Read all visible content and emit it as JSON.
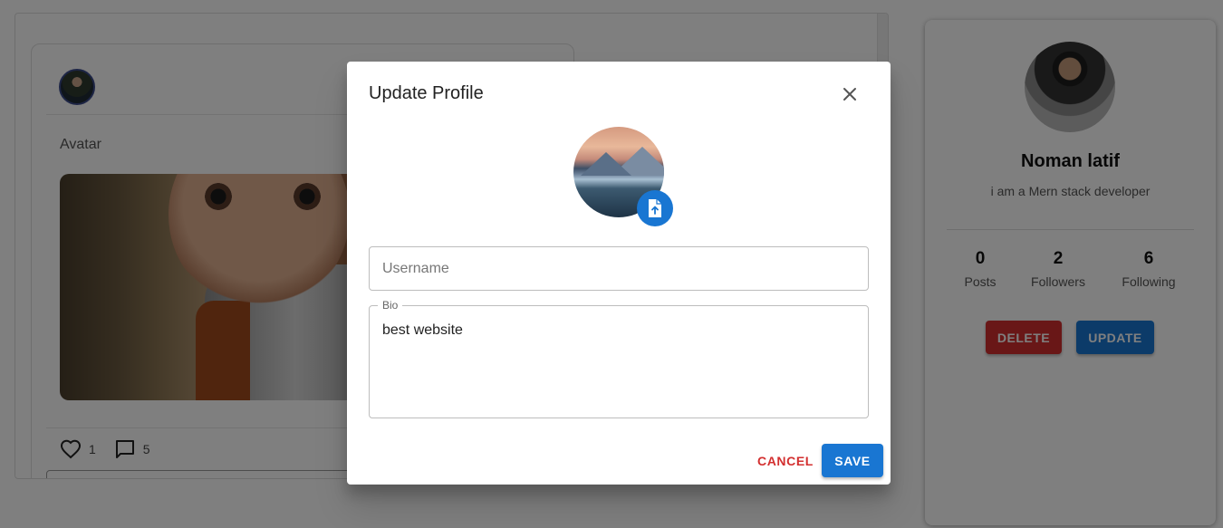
{
  "post": {
    "caption": "Avatar",
    "likes": "1",
    "comments": "5"
  },
  "profile": {
    "name": "Noman latif",
    "bio": "i am a Mern stack developer",
    "stats": [
      {
        "value": "0",
        "label": "Posts"
      },
      {
        "value": "2",
        "label": "Followers"
      },
      {
        "value": "6",
        "label": "Following"
      }
    ],
    "delete_label": "DELETE",
    "update_label": "UPDATE"
  },
  "dialog": {
    "title": "Update Profile",
    "username_placeholder": "Username",
    "username_value": "",
    "bio_label": "Bio",
    "bio_value": "best website",
    "cancel_label": "CANCEL",
    "save_label": "SAVE"
  },
  "colors": {
    "primary": "#1976d2",
    "danger": "#d32f2f",
    "backdrop": "rgba(0,0,0,0.5)"
  },
  "icons": {
    "close": "close-icon",
    "upload": "file-upload-icon",
    "like": "heart-outline-icon",
    "comment": "comment-outline-icon"
  }
}
